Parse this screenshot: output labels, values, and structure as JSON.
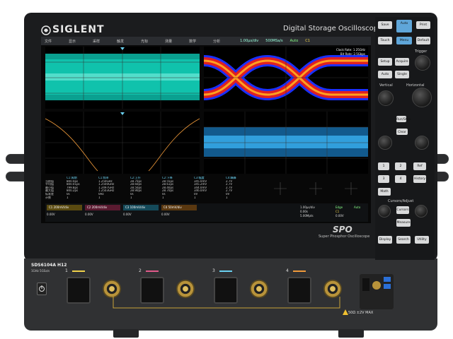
{
  "brand": "SIGLENT",
  "product_title": "Digital Storage Oscilloscope",
  "model": "SDS6104A H12",
  "model_spec": "1GHz 5GSa/s",
  "spo_logo": "SPO",
  "spo_tagline": "Super Phosphor Oscilloscope",
  "max_input": "50Ω ±2V MAX",
  "toolbar": {
    "items": [
      "文件",
      "显示",
      "采样",
      "触发",
      "光标",
      "测量",
      "数学",
      "分析"
    ],
    "right": [
      "1.00μs/div",
      "500MSa/s",
      "Auto",
      "C1"
    ]
  },
  "grid2": {
    "info1": "Clock Rate: 1.25GHz",
    "info2": "Bit Rate: 2.5Gbps"
  },
  "measure": {
    "headers": [
      "",
      "C1:周期",
      "C1:频率",
      "C2:上升",
      "C2:下降",
      "C3:幅度",
      "C4:峰峰"
    ],
    "rows": [
      [
        "当前值",
        "800.0ps",
        "1.250GHz",
        "28.70ps",
        "28.55ps",
        "345.0mV",
        "2.7V"
      ],
      [
        "平均值",
        "800.01ps",
        "1.2500GHz",
        "28.60ps",
        "28.61ps",
        "345.2mV",
        "2.7V"
      ],
      [
        "最小值",
        "799.8ps",
        "1.2497GHz",
        "28.50ps",
        "28.40ps",
        "344.0mV",
        "2.7V"
      ],
      [
        "最大值",
        "800.2ps",
        "1.2503GHz",
        "28.90ps",
        "28.70ps",
        "346.0mV",
        "2.7V"
      ],
      [
        "标准差",
        "0s",
        "0Hz",
        "0s",
        "0s",
        "0V",
        "0V"
      ],
      [
        "计数",
        "1",
        "1",
        "1",
        "1",
        "1",
        "1"
      ]
    ]
  },
  "channels": [
    {
      "name": "C1",
      "color": "#f0d24a",
      "scale": "200mV/div",
      "offset": "0.00V"
    },
    {
      "name": "C2",
      "color": "#e05a8a",
      "scale": "200mV/div",
      "offset": "0.00V"
    },
    {
      "name": "C3",
      "color": "#6ad0f0",
      "scale": "100mV/div",
      "offset": "0.00V"
    },
    {
      "name": "C4",
      "color": "#f09a3a",
      "scale": "50mV/div",
      "offset": "0.00V"
    }
  ],
  "timebase": {
    "div": "1.00μs/div",
    "delay": "0.00s",
    "mem": "5.00Mpts"
  },
  "trigger": {
    "type": "Edge",
    "source": "C1",
    "level": "0.00V",
    "mode": "Auto"
  },
  "panel": {
    "buttons": [
      "Save",
      "Auto",
      "Touch",
      "Menu",
      "Setup",
      "Acquire",
      "Auto",
      "Single",
      "Run/Stop",
      "Clear",
      "Default",
      "Print",
      "History",
      "Ref",
      "Math",
      "Cursors",
      "Measure",
      "Display",
      "Search",
      "Navigate",
      "Utility",
      "Decode"
    ],
    "labels": [
      "Trigger",
      "Vertical",
      "Horizontal",
      "Cursors/Adjust"
    ],
    "ch_numbers": [
      "1",
      "2",
      "3",
      "4"
    ]
  },
  "front_channels": [
    "1",
    "2",
    "3",
    "4"
  ]
}
